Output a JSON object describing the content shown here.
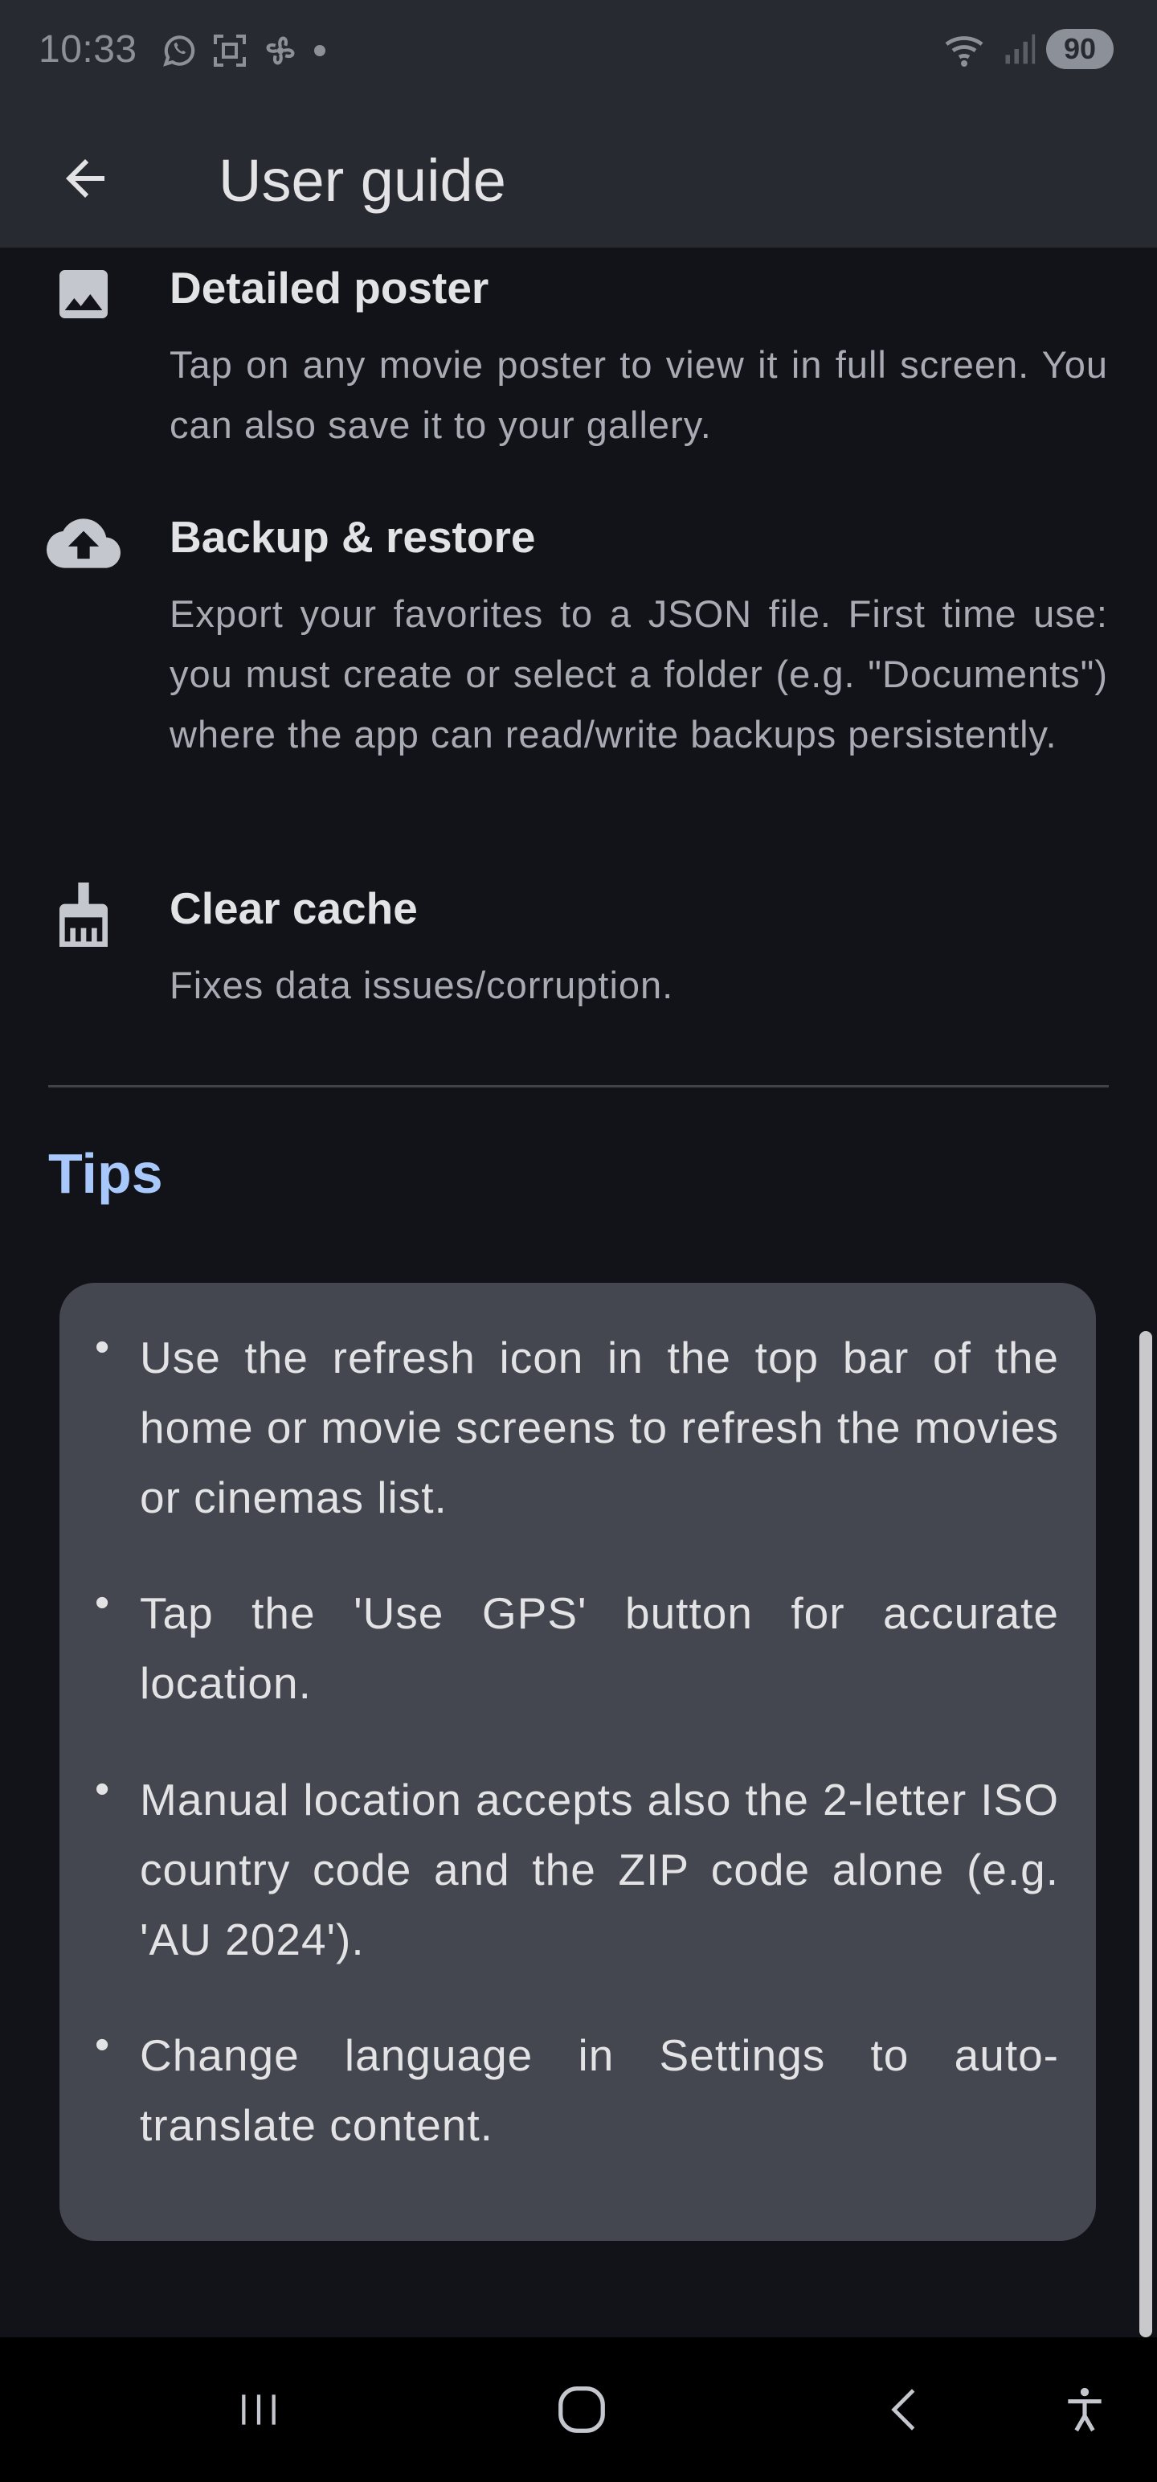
{
  "status_bar": {
    "time": "10:33",
    "battery": "90",
    "icons": [
      "whatsapp-icon",
      "screenshot-icon",
      "fan-icon",
      "dot-icon",
      "wifi-icon",
      "signal-icon"
    ]
  },
  "app_bar": {
    "title": "User guide",
    "back_icon": "arrow-back-icon"
  },
  "features": [
    {
      "icon": "image-icon",
      "title": "Detailed poster",
      "description": "Tap on any movie poster to view it in full screen. You can also save it to your gallery."
    },
    {
      "icon": "cloud-upload-icon",
      "title": "Backup & restore",
      "description": "Export your favorites to a JSON file. First time use: you must create or select a folder (e.g. \"Documents\") where the app can read/write backups persistently."
    },
    {
      "icon": "broom-icon",
      "title": "Clear cache",
      "description": "Fixes data issues/corruption."
    }
  ],
  "tips": {
    "heading": "Tips",
    "items": [
      "Use the refresh icon in the top bar of the home or movie screens to refresh the movies or cinemas list.",
      "Tap the 'Use GPS' button for accurate location.",
      "Manual location accepts also the 2-letter ISO country code and the ZIP code alone (e.g. 'AU 2024').",
      "Change language in Settings to auto-translate content."
    ]
  },
  "colors": {
    "background": "#111318",
    "app_bar": "#272a31",
    "tips_card": "#44474f",
    "accent": "#a8c7fa"
  },
  "nav_bar": {
    "icons": [
      "recents-icon",
      "home-icon",
      "back-nav-icon",
      "accessibility-icon"
    ]
  }
}
